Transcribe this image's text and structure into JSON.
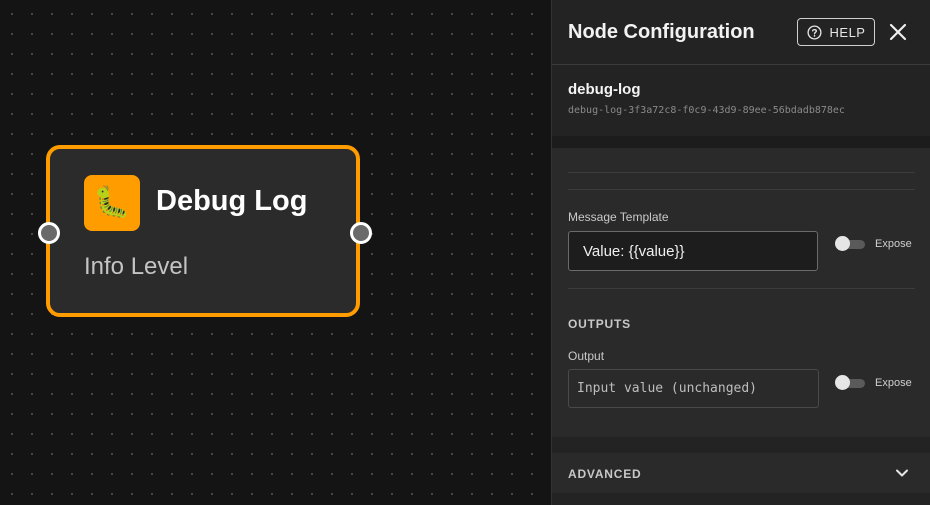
{
  "node": {
    "title": "Debug Log",
    "subtitle": "Info Level",
    "icon": "caterpillar-bug-icon",
    "icon_glyph": "🐛",
    "accent_color": "#ff9c00"
  },
  "panel": {
    "title": "Node Configuration",
    "help_label": "HELP",
    "close_icon": "close-icon",
    "node_name": "debug-log",
    "node_id": "debug-log-3f3a72c8-f0c9-43d9-89ee-56bdadb878ec",
    "message_template": {
      "label": "Message Template",
      "value": "Value: {{value}}",
      "expose_label": "Expose",
      "exposed": false
    },
    "outputs": {
      "heading": "OUTPUTS",
      "output_label": "Output",
      "output_value": "Input value (unchanged)",
      "expose_label": "Expose",
      "exposed": false
    },
    "advanced_label": "ADVANCED"
  }
}
